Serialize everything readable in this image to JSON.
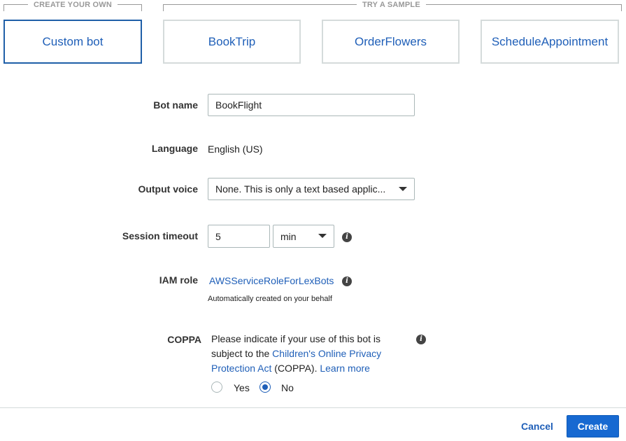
{
  "groups": {
    "create_own": "CREATE YOUR OWN",
    "try_sample": "TRY A SAMPLE"
  },
  "templates": [
    {
      "label": "Custom bot",
      "selected": true
    },
    {
      "label": "BookTrip",
      "selected": false
    },
    {
      "label": "OrderFlowers",
      "selected": false
    },
    {
      "label": "ScheduleAppointment",
      "selected": false
    }
  ],
  "form": {
    "bot_name": {
      "label": "Bot name",
      "value": "BookFlight"
    },
    "language": {
      "label": "Language",
      "value": "English (US)"
    },
    "output_voice": {
      "label": "Output voice",
      "value": "None. This is only a text based applic..."
    },
    "session_timeout": {
      "label": "Session timeout",
      "value": "5",
      "unit": "min"
    },
    "iam_role": {
      "label": "IAM role",
      "value": "AWSServiceRoleForLexBots",
      "hint": "Automatically created on your behalf"
    },
    "coppa": {
      "label": "COPPA",
      "text_before": "Please indicate if your use of this bot is subject to the ",
      "link_act": "Children's Online Privacy Protection Act",
      "text_mid": " (COPPA). ",
      "link_learn": "Learn more",
      "options": [
        {
          "label": "Yes",
          "checked": false
        },
        {
          "label": "No",
          "checked": true
        }
      ]
    }
  },
  "footer": {
    "cancel": "Cancel",
    "create": "Create"
  },
  "colors": {
    "link": "#1f5fb8",
    "primary_button": "#1769d1",
    "selected_border": "#1f5fa8"
  }
}
